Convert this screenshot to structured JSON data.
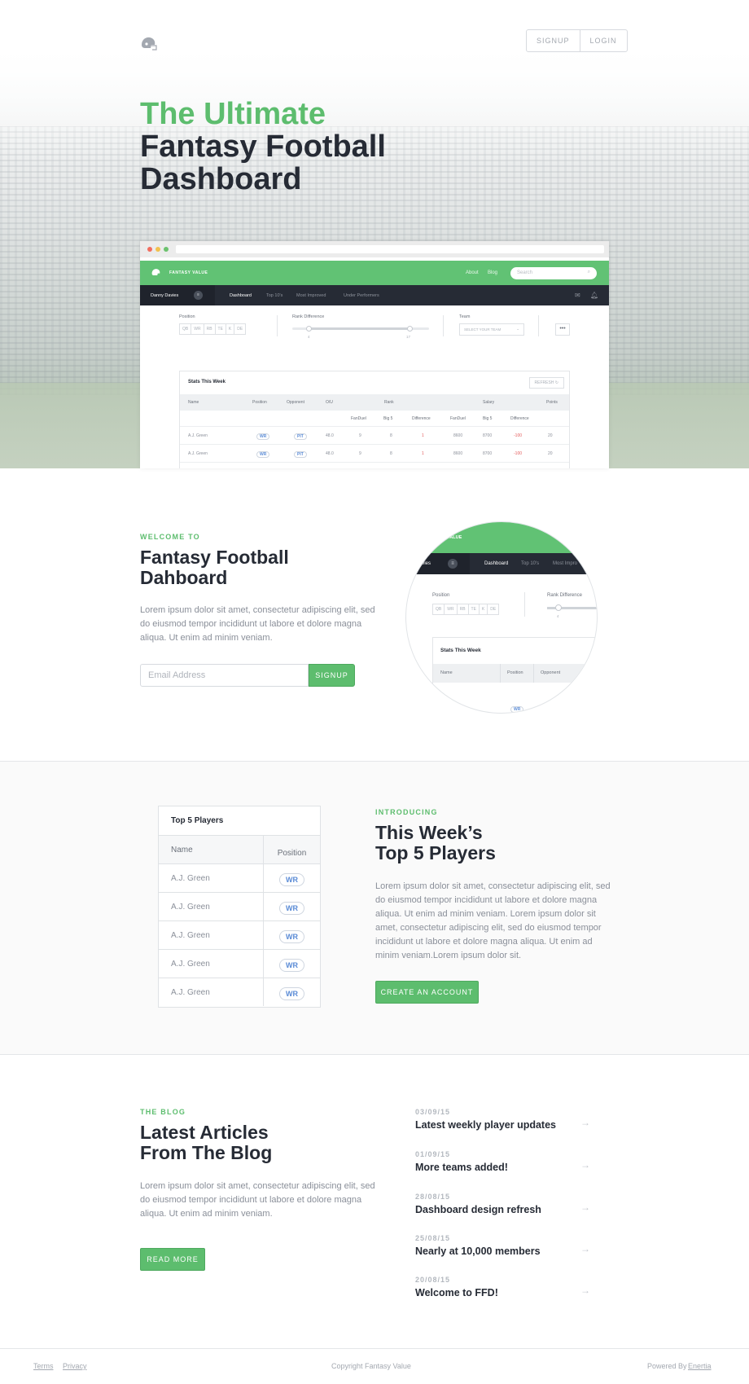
{
  "header": {
    "signup_label": "SIGNUP",
    "login_label": "LOGIN"
  },
  "hero": {
    "title_line1": "The Ultimate",
    "title_line2": "Fantasy Football",
    "title_line3": "Dashboard"
  },
  "dashboard": {
    "brand": "FANTASY VALUE",
    "nav_about": "About",
    "nav_blog": "Blog",
    "search_placeholder": "Search",
    "user_name": "Danny Davies",
    "tabs": [
      "Dashboard",
      "Top 10's",
      "Most Improved",
      "Under Performers"
    ],
    "position_label": "Position",
    "position_chips": [
      "QB",
      "WR",
      "RB",
      "TE",
      "K",
      "DE"
    ],
    "rank_diff_label": "Rank Difference",
    "rank_min": "4",
    "rank_max": "17",
    "team_label": "Team",
    "team_select": "SELECT YOUR TEAM",
    "table_title": "Stats This Week",
    "refresh_label": "REFRESH",
    "headers": [
      "Name",
      "Position",
      "Opponent",
      "O/U",
      "Rank",
      "Salary",
      "Points"
    ],
    "sub_headers": [
      "FanDuel",
      "Big 5",
      "Difference",
      "FanDuel",
      "Big 5",
      "Difference"
    ],
    "rows": [
      {
        "name": "A.J. Green",
        "position": "WR",
        "opponent": "PIT",
        "ou": "48.0",
        "rank_fd": "9",
        "rank_b5": "8",
        "rank_diff": "1",
        "sal_fd": "8600",
        "sal_b5": "8700",
        "sal_diff": "-100",
        "points": "20"
      },
      {
        "name": "A.J. Green",
        "position": "WR",
        "opponent": "PIT",
        "ou": "48.0",
        "rank_fd": "9",
        "rank_b5": "8",
        "rank_diff": "1",
        "sal_fd": "8600",
        "sal_b5": "8700",
        "sal_diff": "-100",
        "points": "20"
      }
    ]
  },
  "welcome": {
    "eyebrow": "WELCOME TO",
    "title_line1": "Fantasy Football",
    "title_line2": "Dahboard",
    "body": "Lorem ipsum dolor sit amet, consectetur adipiscing elit, sed do eiusmod tempor incididunt ut labore et dolore magna aliqua. Ut enim ad minim veniam.",
    "email_placeholder": "Email Address",
    "signup_button": "SIGNUP"
  },
  "circle_preview": {
    "brand_fragment": "VALUE",
    "user_fragment": "avies",
    "tab_dashboard": "Dashboard",
    "tab_top": "Top 10's",
    "tab_most": "Most Impro",
    "position_label": "Position",
    "chips": [
      "QB",
      "WR",
      "RB",
      "TE",
      "K",
      "DE"
    ],
    "rank_label": "Rank Difference",
    "rank_min": "4",
    "table_title": "Stats This Week",
    "col_name": "Name",
    "col_position": "Position",
    "col_opponent": "Opponent",
    "pill": "WR"
  },
  "top5": {
    "table_title": "Top 5 Players",
    "col_name": "Name",
    "col_position": "Position",
    "players": [
      {
        "name": "A.J. Green",
        "position": "WR"
      },
      {
        "name": "A.J. Green",
        "position": "WR"
      },
      {
        "name": "A.J. Green",
        "position": "WR"
      },
      {
        "name": "A.J. Green",
        "position": "WR"
      },
      {
        "name": "A.J. Green",
        "position": "WR"
      }
    ],
    "eyebrow": "INTRODUCING",
    "title_line1": "This Week’s",
    "title_line2": "Top 5 Players",
    "body": "Lorem ipsum dolor sit amet, consectetur adipiscing elit, sed do eiusmod tempor incididunt ut labore et dolore magna aliqua. Ut enim ad minim veniam. Lorem ipsum dolor sit amet, consectetur adipiscing elit, sed do eiusmod tempor incididunt ut labore et dolore magna aliqua. Ut enim ad minim veniam.Lorem ipsum dolor sit.",
    "cta": "CREATE AN ACCOUNT"
  },
  "blog": {
    "eyebrow": "THE BLOG",
    "title_line1": "Latest Articles",
    "title_line2": "From The Blog",
    "body": "Lorem ipsum dolor sit amet, consectetur adipiscing elit, sed do eiusmod tempor incididunt ut labore et dolore magna aliqua. Ut enim ad minim veniam.",
    "read_more": "READ MORE",
    "posts": [
      {
        "date": "03/09/15",
        "title": "Latest weekly player updates"
      },
      {
        "date": "01/09/15",
        "title": "More teams added!"
      },
      {
        "date": "28/08/15",
        "title": "Dashboard design refresh"
      },
      {
        "date": "25/08/15",
        "title": "Nearly at 10,000 members"
      },
      {
        "date": "20/08/15",
        "title": "Welcome to FFD!"
      }
    ]
  },
  "footer": {
    "terms": "Terms",
    "privacy": "Privacy",
    "copyright": "Copyright Fantasy Value",
    "powered_by": "Powered By",
    "powered_link": "Enertia"
  },
  "colors": {
    "accent": "#5dbd6e",
    "dark": "#262b35",
    "negative": "#e35b5b",
    "pill": "#5a8bd6"
  }
}
